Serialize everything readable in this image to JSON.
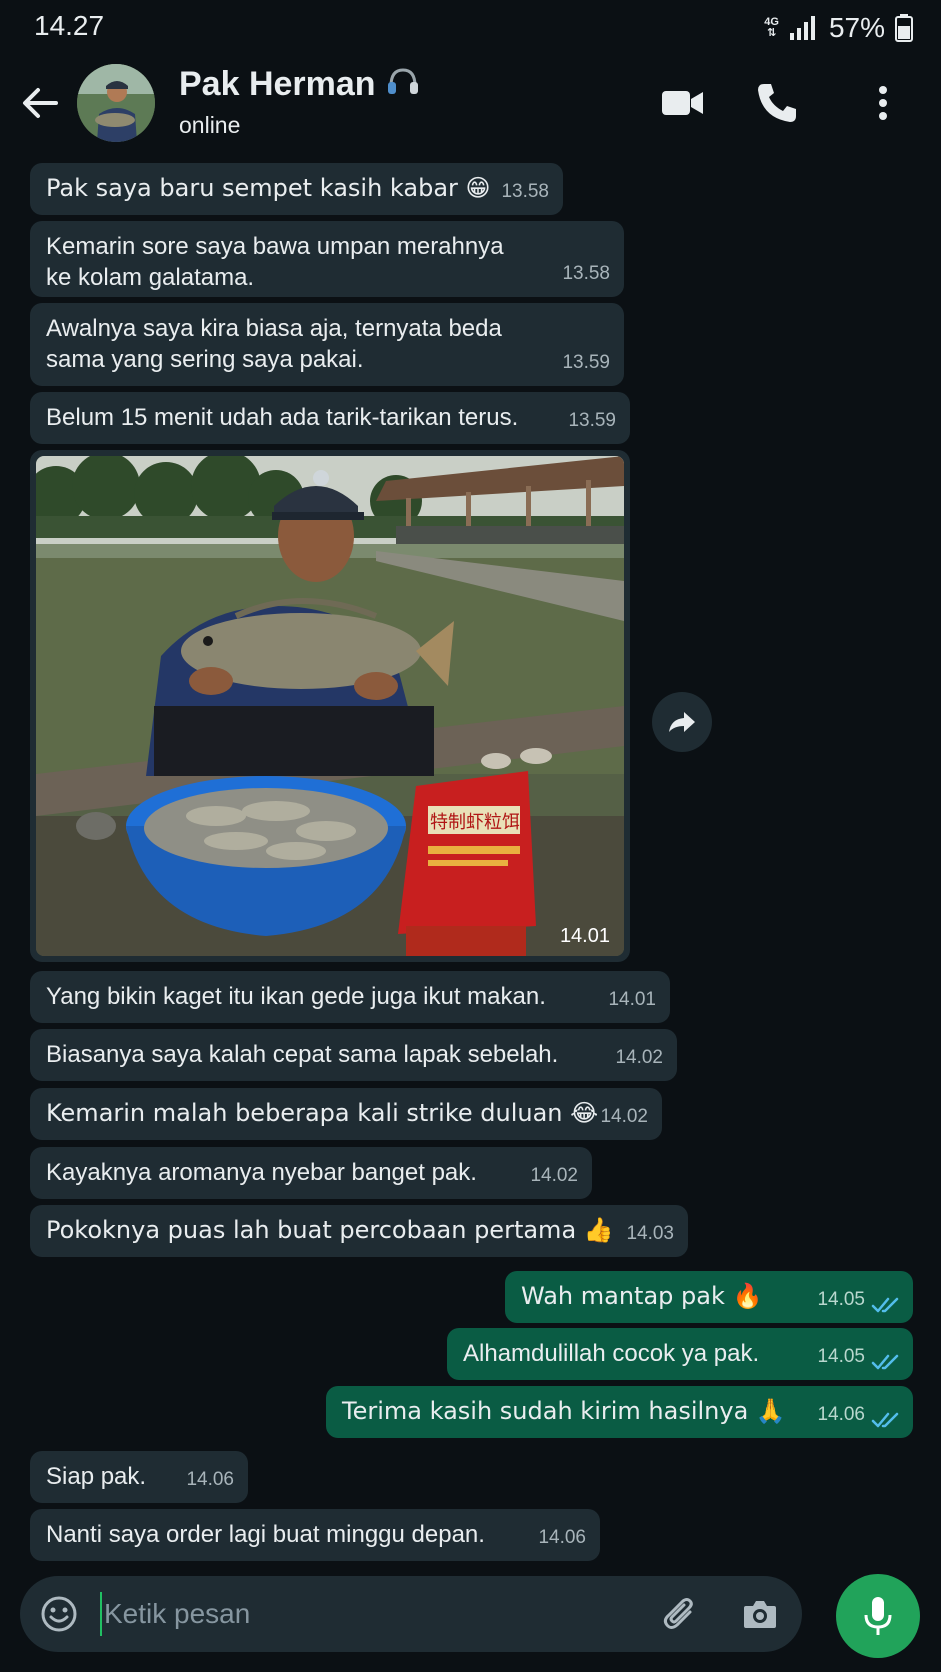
{
  "status_bar": {
    "time": "14.27",
    "network": "4G",
    "battery": "57%"
  },
  "header": {
    "name": "Pak Herman",
    "status": "online",
    "name_badge_icon": "headphones-icon"
  },
  "messages": [
    {
      "dir": "in",
      "text": "Pak saya baru sempet kasih kabar 😁",
      "time": "13.58"
    },
    {
      "dir": "in",
      "text": "Kemarin sore saya bawa umpan merahnya\nke kolam galatama.",
      "time": "13.58"
    },
    {
      "dir": "in",
      "text": "Awalnya saya kira biasa aja, ternyata beda\nsama yang sering saya pakai.",
      "time": "13.59"
    },
    {
      "dir": "in",
      "text": "Belum 15 menit udah ada tarik-tarikan terus.",
      "time": "13.59"
    },
    {
      "dir": "in",
      "type": "image",
      "time": "14.01"
    },
    {
      "dir": "in",
      "text": "Yang bikin kaget itu ikan gede juga ikut makan.",
      "time": "14.01"
    },
    {
      "dir": "in",
      "text": "Biasanya saya kalah cepat sama lapak sebelah.",
      "time": "14.02"
    },
    {
      "dir": "in",
      "text": "Kemarin malah beberapa kali strike duluan 😂",
      "time": "14.02"
    },
    {
      "dir": "in",
      "text": "Kayaknya aromanya nyebar banget pak.",
      "time": "14.02"
    },
    {
      "dir": "in",
      "text": "Pokoknya puas lah buat percobaan pertama 👍",
      "time": "14.03"
    },
    {
      "dir": "out",
      "text": "Wah mantap pak 🔥",
      "time": "14.05"
    },
    {
      "dir": "out",
      "text": "Alhamdulillah cocok ya pak.",
      "time": "14.05"
    },
    {
      "dir": "out",
      "text": "Terima kasih sudah kirim hasilnya 🙏",
      "time": "14.06"
    },
    {
      "dir": "in",
      "text": "Siap pak.",
      "time": "14.06"
    },
    {
      "dir": "in",
      "text": "Nanti saya order lagi buat minggu depan.",
      "time": "14.06"
    }
  ],
  "photo": {
    "package_text": "特制虾粒饵"
  },
  "composer": {
    "placeholder": "Ketik pesan",
    "value": ""
  },
  "colors": {
    "background": "#0b1014",
    "incoming": "#1f2c33",
    "outgoing": "#0a5c44",
    "accent": "#21a35a",
    "read_ticks": "#53bdeb"
  }
}
